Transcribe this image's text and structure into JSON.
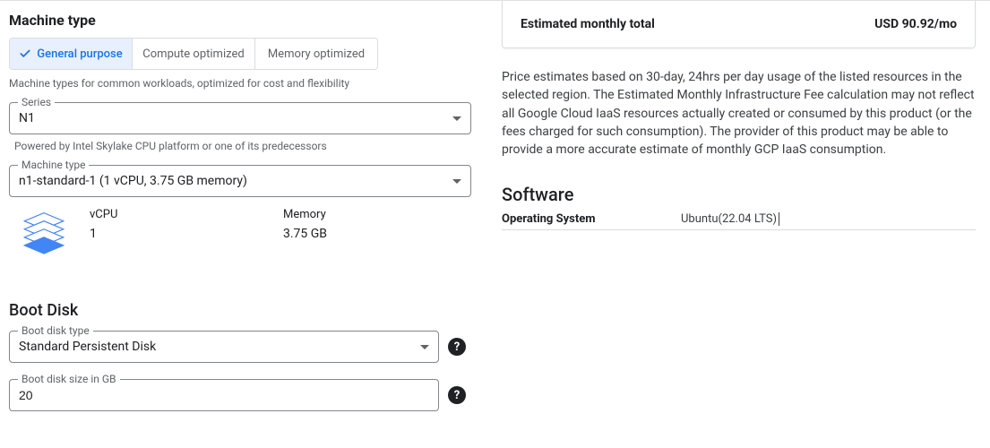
{
  "left": {
    "machine_type_title": "Machine type",
    "tabs": {
      "general": "General purpose",
      "compute": "Compute optimized",
      "memory": "Memory optimized"
    },
    "tabs_helper": "Machine types for common workloads, optimized for cost and flexibility",
    "series": {
      "label": "Series",
      "value": "N1",
      "helper": "Powered by Intel Skylake CPU platform or one of its predecessors"
    },
    "machine_type_field": {
      "label": "Machine type",
      "value": "n1-standard-1 (1 vCPU, 3.75 GB memory)"
    },
    "specs": {
      "vcpu_label": "vCPU",
      "vcpu_value": "1",
      "memory_label": "Memory",
      "memory_value": "3.75 GB"
    },
    "boot_disk_title": "Boot Disk",
    "boot_disk_type": {
      "label": "Boot disk type",
      "value": "Standard Persistent Disk"
    },
    "boot_disk_size": {
      "label": "Boot disk size in GB",
      "value": "20"
    }
  },
  "right": {
    "est_label": "Estimated monthly total",
    "est_value": "USD 90.92/mo",
    "disclaimer": "Price estimates based on 30-day, 24hrs per day usage of the listed resources in the selected region. The Estimated Monthly Infrastructure Fee calculation may not reflect all Google Cloud IaaS resources actually created or consumed by this product (or the fees charged for such consumption). The provider of this product may be able to provide a more accurate estimate of monthly GCP IaaS consumption.",
    "software_title": "Software",
    "software_label": "Operating System",
    "software_value": "Ubuntu(22.04 LTS)"
  }
}
